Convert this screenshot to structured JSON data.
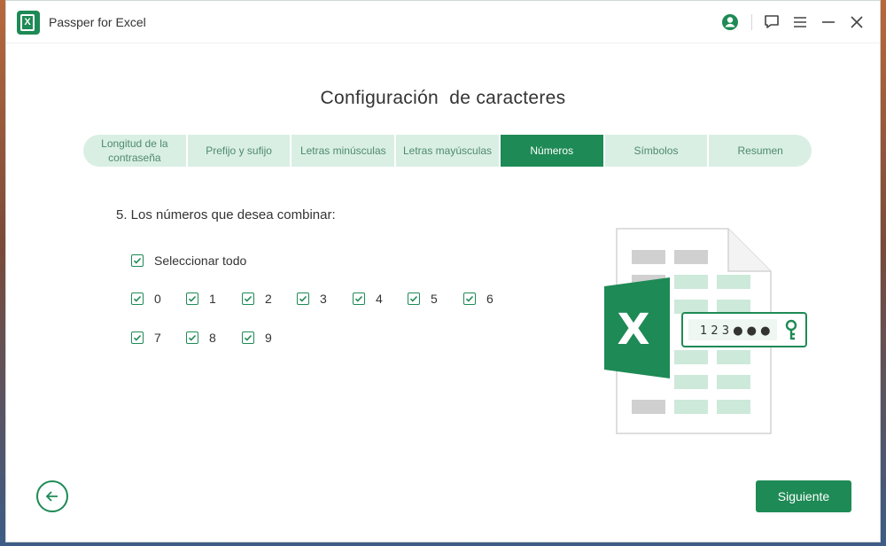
{
  "app": {
    "title": "Passper for Excel",
    "logo_letter": "X"
  },
  "heading": "Configuración  de caracteres",
  "steps": [
    {
      "label": "Longitud de la contraseña",
      "active": false
    },
    {
      "label": "Prefijo y sufijo",
      "active": false
    },
    {
      "label": "Letras minúsculas",
      "active": false
    },
    {
      "label": "Letras mayúsculas",
      "active": false
    },
    {
      "label": "Números",
      "active": true
    },
    {
      "label": "Símbolos",
      "active": false
    },
    {
      "label": "Resumen",
      "active": false
    }
  ],
  "question": "5. Los números que desea combinar:",
  "select_all": {
    "label": "Seleccionar todo",
    "checked": true
  },
  "digits": [
    {
      "label": "0",
      "checked": true
    },
    {
      "label": "1",
      "checked": true
    },
    {
      "label": "2",
      "checked": true
    },
    {
      "label": "3",
      "checked": true
    },
    {
      "label": "4",
      "checked": true
    },
    {
      "label": "5",
      "checked": true
    },
    {
      "label": "6",
      "checked": true
    },
    {
      "label": "7",
      "checked": true
    },
    {
      "label": "8",
      "checked": true
    },
    {
      "label": "9",
      "checked": true
    }
  ],
  "illustration": {
    "logo_letter": "X",
    "password_text": "1 2 3 ● ● ●"
  },
  "buttons": {
    "next_label": "Siguiente"
  },
  "colors": {
    "accent": "#1e8a55",
    "step_inactive": "#d9efe4"
  },
  "icons": {
    "account": "account-icon",
    "feedback": "feedback-icon",
    "menu": "menu-icon",
    "minimize": "minimize-icon",
    "close": "close-icon",
    "back": "arrow-left-icon",
    "check": "check-icon",
    "key": "key-icon"
  }
}
